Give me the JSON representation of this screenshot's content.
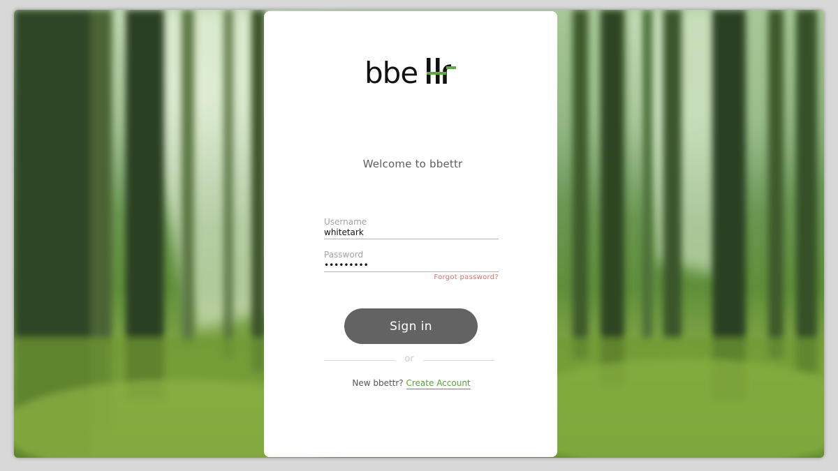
{
  "brand": {
    "logo_text": "bbettr",
    "accent_color": "#5aac3a",
    "logo_color": "#111111"
  },
  "welcome_text": "Welcome to bbettr",
  "username": {
    "label": "Username",
    "value": "whitetark"
  },
  "password": {
    "label": "Password",
    "value": "•••••••••"
  },
  "forgot_password": "Forgot password?",
  "sign_in_button": "Sign in",
  "divider_text": "or",
  "signup": {
    "prompt": "New bbettr?",
    "link": "Create Account"
  },
  "colors": {
    "button": "#636363",
    "forgot": "#e56a63",
    "link": "#5d9e3a"
  },
  "background": {
    "description_icon": "forest-photo"
  }
}
